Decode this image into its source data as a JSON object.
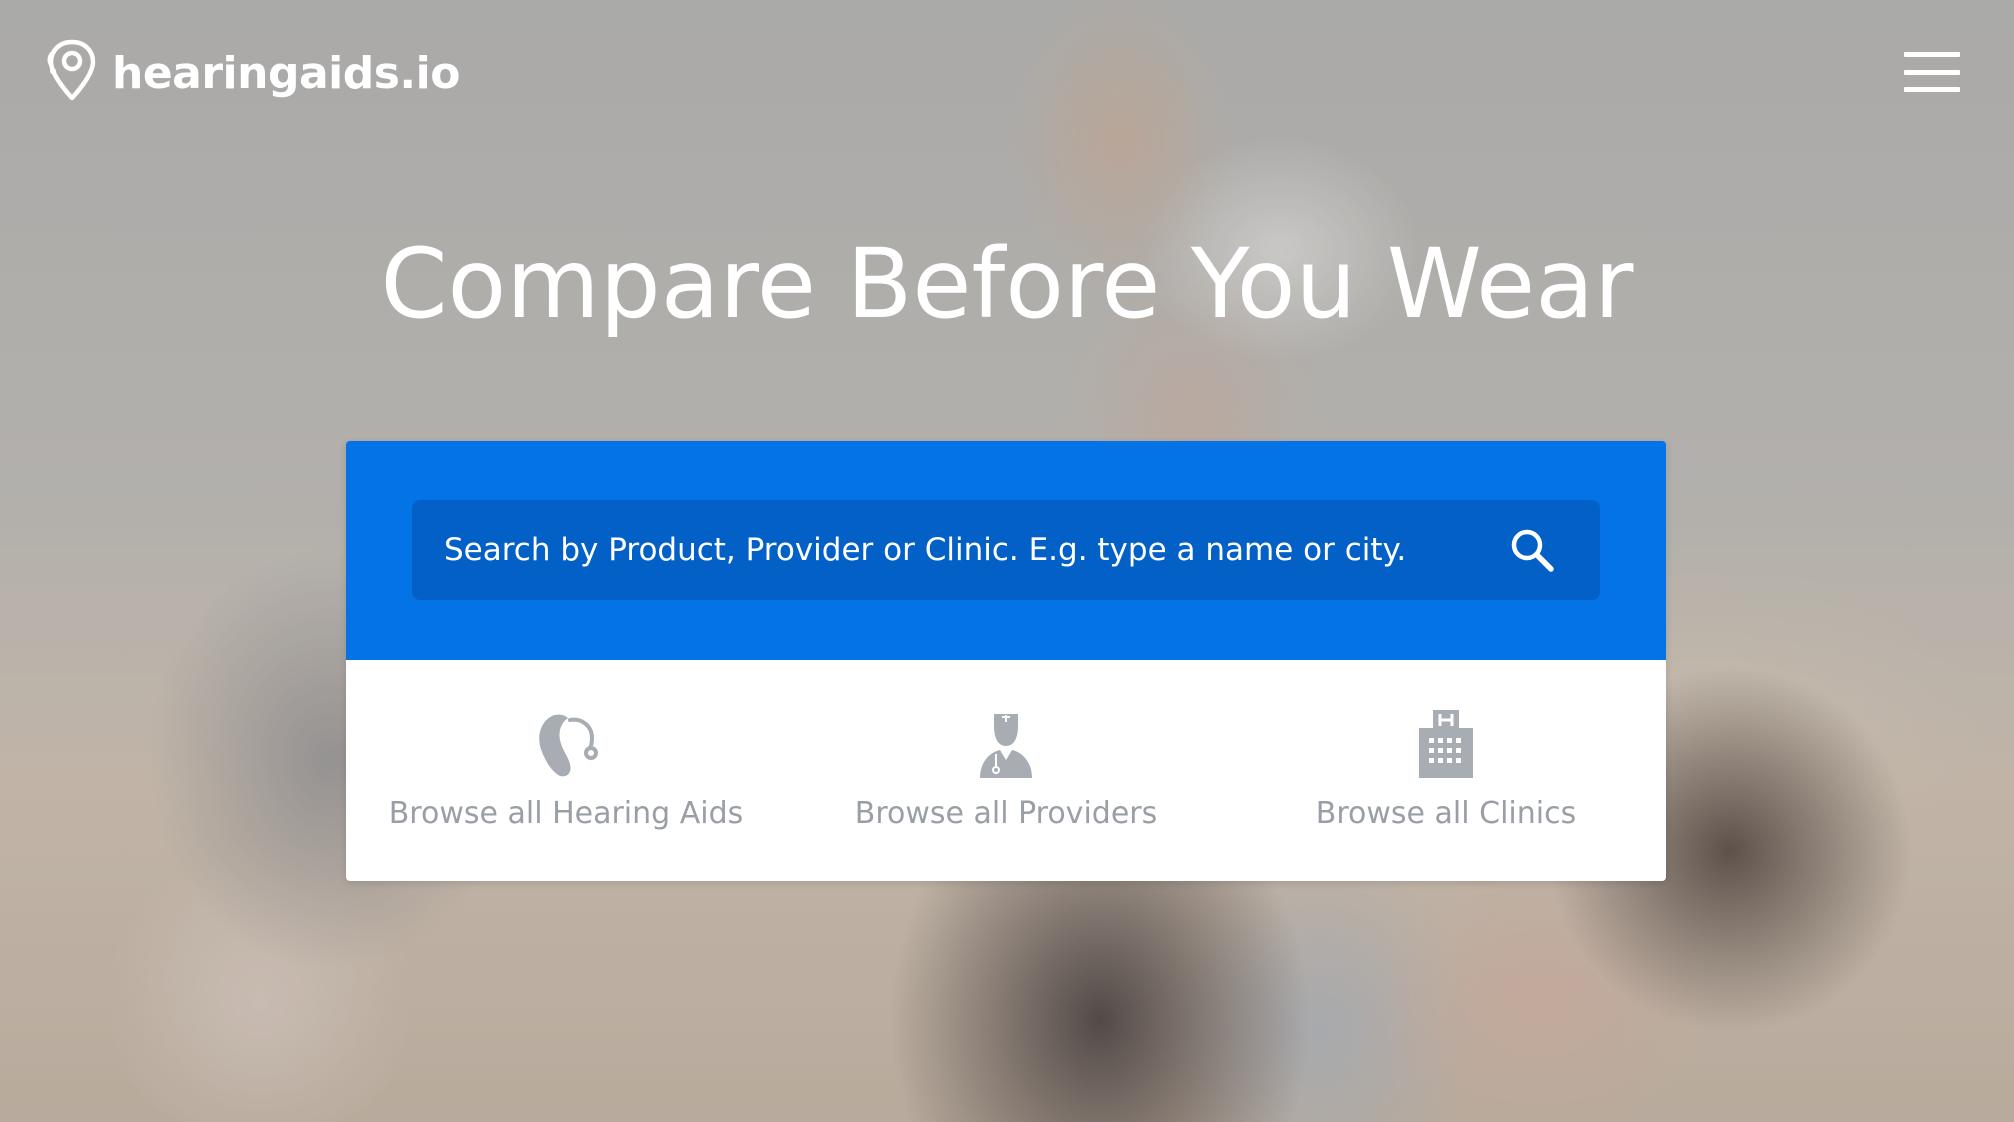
{
  "header": {
    "logo_text": "hearingaids.io",
    "menu_icon": "hamburger-menu-icon"
  },
  "hero": {
    "headline": "Compare Before You Wear"
  },
  "search": {
    "placeholder": "Search by Product, Provider or Clinic. E.g. type a name or city.",
    "icon": "search-icon"
  },
  "browse": {
    "items": [
      {
        "label": "Browse all Hearing Aids",
        "icon": "hearing-aid-icon"
      },
      {
        "label": "Browse all Providers",
        "icon": "doctor-icon"
      },
      {
        "label": "Browse all Clinics",
        "icon": "hospital-icon"
      }
    ]
  },
  "colors": {
    "brand_blue": "#0473e6",
    "search_field": "#0360c7",
    "browse_text": "#9a9ea6",
    "icon_gray": "#a8acb3"
  }
}
